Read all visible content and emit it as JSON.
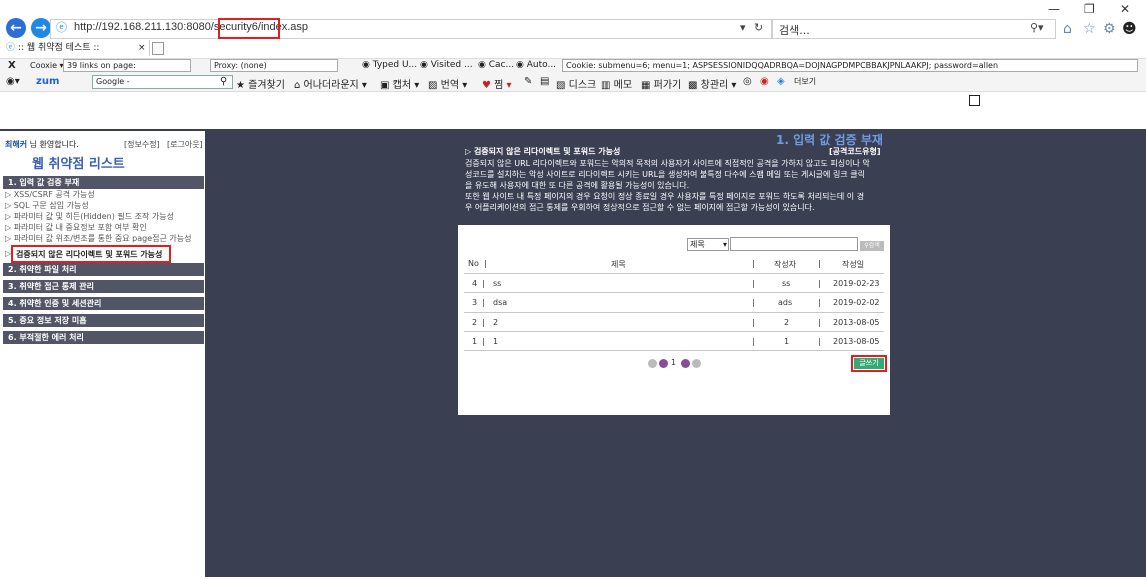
{
  "browser": {
    "url": "http://192.168.211.130:8080/security",
    "url_highlight": "6/index.asp",
    "search_placeholder": "검색...",
    "tab_title": ":: 웹 취약점 테스트 ::"
  },
  "toolbar1": {
    "close": "X",
    "cooxie": "Cooxie",
    "links": "39 links on page:",
    "proxy": "Proxy: (none)",
    "typed": "Typed U...",
    "visited": "Visited ...",
    "cac": "Cac...",
    "auto": "Auto...",
    "cookie": "Cookie: submenu=6; menu=1; ASPSESSIONIDQQADRBQA=DOJNAGPDMPCBBAKJPNLAAKPJ; password=allen"
  },
  "toolbar2": {
    "zum": "zum",
    "google": "Google -",
    "bookmarks": "즐겨찾기",
    "ernst": "어나더라운지",
    "capture": "캡처",
    "translate": "번역",
    "zzim": "찜",
    "disk": "디스크",
    "memo": "메모",
    "printer": "퍼가기",
    "window": "창관리",
    "more": "더보기"
  },
  "left": {
    "user": "최해커",
    "welcome": "님 환영합니다.",
    "edit": "[정보수정]",
    "logout": "[로그아웃]",
    "title": "웹 취약점 리스트",
    "menu": [
      {
        "label": "1. 입력 값 검증 부재"
      },
      {
        "label": "2. 취약한 파일 처리"
      },
      {
        "label": "3. 취약한 접근 통제 관리"
      },
      {
        "label": "4. 취약한 인증 및 세션관리"
      },
      {
        "label": "5. 중요 정보 저장 미흡"
      },
      {
        "label": "6. 부적절한 에러 처리"
      }
    ],
    "sub": [
      "▷ XSS/CSRF 공격 가능성",
      "▷ SQL 구문 삽입 가능성",
      "▷ 파라미터 값 및 히든(Hidden) 필드 조작 가능성",
      "▷ 파라미터 값 내 중요정보 포함 여부 확인",
      "▷ 파라미터 값 위조/변조를 통한 중요 page접근 가능성",
      "검증되지 않은 리다이렉트 및 포워드 가능성"
    ],
    "sub_arrow": "▷"
  },
  "main": {
    "heading": "1. 입력 값 검증 부재",
    "code": "[공격코드유형]",
    "sub_heading": "▷ 검증되지 않은 리다이렉트 및 포워드 가능성",
    "desc": [
      "검증되지 않은 URL 리다이렉트와 포워드는 악의적 목적의 사용자가 사이트에 직접적인 공격을 가하지 않고도 피싱이나 악",
      "성코드를 설치하는 악성 사이트로 리다이렉트 시키는 URL을 생성하여 불특정 다수에 스팸 메일 또는 게시글에 링크 클릭",
      "을 유도해 사용자에 대한 또 다른 공격에 활용될 가능성이 있습니다.",
      "또한 웹 사이트 내 특정 페이지의 경우 요청이 정상 종료일 경우 사용자를 특정 페이지로 포워드 하도록 처리되는데 이 경",
      "우 어플리케이션의 접근 통제를 우회하여 정상적으로 접근할 수 없는 페이지에 접근할 가능성이 있습니다."
    ]
  },
  "board": {
    "select": "제목",
    "search_btn": "검색",
    "headers": {
      "no": "No",
      "title": "제목",
      "author": "작성자",
      "date": "작성일"
    },
    "rows": [
      {
        "no": "4",
        "title": "ss",
        "author": "ss",
        "date": "2019-02-23"
      },
      {
        "no": "3",
        "title": "dsa",
        "author": "ads",
        "date": "2019-02-02"
      },
      {
        "no": "2",
        "title": "2",
        "author": "2",
        "date": "2013-08-05"
      },
      {
        "no": "1",
        "title": "1",
        "author": "1",
        "date": "2013-08-05"
      }
    ],
    "page": "1",
    "write": "글쓰기"
  }
}
